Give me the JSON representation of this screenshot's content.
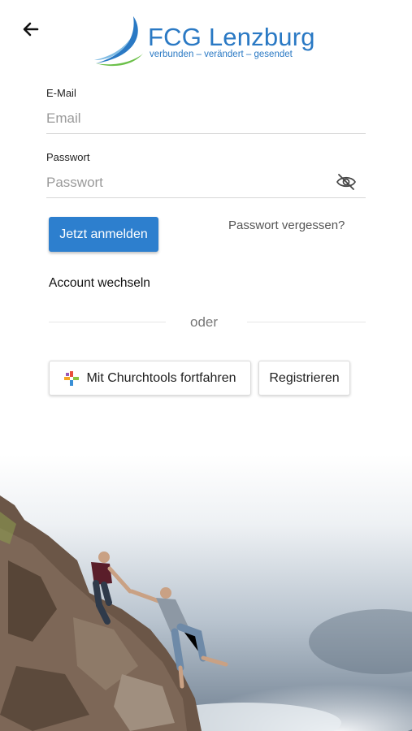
{
  "header": {
    "back_icon": "arrow-left-icon",
    "logo": {
      "brand": "FCG Lenzburg",
      "tagline": "verbunden – verändert – gesendet",
      "colors": {
        "brand": "#2a79c4",
        "swoosh_green": "#6cc04a"
      }
    }
  },
  "form": {
    "email": {
      "label": "E-Mail",
      "placeholder": "Email",
      "value": ""
    },
    "password": {
      "label": "Passwort",
      "placeholder": "Passwort",
      "value": "",
      "toggle_icon": "eye-off-icon"
    },
    "login_button": "Jetzt anmelden",
    "forgot_link": "Passwort vergessen?",
    "switch_account": "Account wechseln",
    "divider_text": "oder",
    "churchtools_button": "Mit Churchtools fortfahren",
    "churchtools_icon": "churchtools-cross-icon",
    "register_button": "Registrieren"
  },
  "theme": {
    "accent": "#2d7fce"
  },
  "hero": {
    "image": "climbers-helping-hand-photo"
  }
}
